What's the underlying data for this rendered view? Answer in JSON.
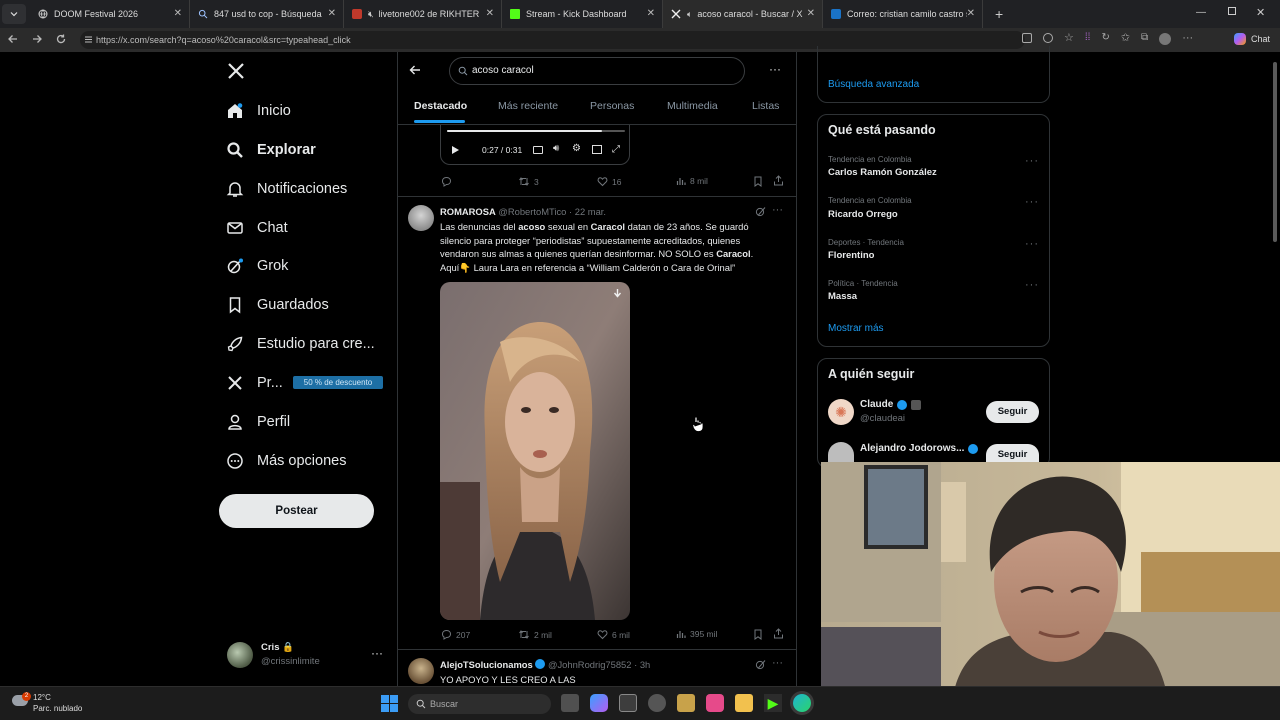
{
  "browser": {
    "tabs": [
      {
        "title": "DOOM Festival 2026",
        "icon": "globe-icon"
      },
      {
        "title": "847 usd to cop - Búsqueda",
        "icon": "search-icon"
      },
      {
        "title": "livetone002 de RIKHTER",
        "icon": "speaker-muted-icon"
      },
      {
        "title": "Stream - Kick Dashboard",
        "icon": "kick-icon"
      },
      {
        "title": "acoso caracol - Buscar / X",
        "icon": "x-logo-icon"
      },
      {
        "title": "Correo: cristian camilo castro soto",
        "icon": "outlook-icon"
      }
    ],
    "url": "https://x.com/search?q=acoso%20caracol&src=typeahead_click",
    "chat_label": "Chat"
  },
  "sidebar": {
    "items": [
      {
        "label": "Inicio",
        "icon": "home-icon"
      },
      {
        "label": "Explorar",
        "icon": "search-icon"
      },
      {
        "label": "Notificaciones",
        "icon": "bell-icon"
      },
      {
        "label": "Chat",
        "icon": "mail-icon"
      },
      {
        "label": "Grok",
        "icon": "grok-icon"
      },
      {
        "label": "Guardados",
        "icon": "bookmark-icon"
      },
      {
        "label": "Estudio para cre...",
        "icon": "rocket-icon"
      },
      {
        "label": "Pr...",
        "icon": "x-logo-icon"
      },
      {
        "label": "Perfil",
        "icon": "person-icon"
      },
      {
        "label": "Más opciones",
        "icon": "more-circle-icon"
      }
    ],
    "premium_badge": "50 % de descuento",
    "post_button": "Postear",
    "account": {
      "name": "Cris 🔒",
      "handle": "@crissinlimite"
    }
  },
  "search": {
    "query": "acoso caracol",
    "tabs": [
      "Destacado",
      "Más reciente",
      "Personas",
      "Multimedia",
      "Listas"
    ],
    "active_tab": "Destacado"
  },
  "feed": {
    "prev_tweet": {
      "player_time": "0:27 / 0:31",
      "replies": "",
      "reposts": "3",
      "likes": "16",
      "views": "8 mil"
    },
    "tweet": {
      "name": "ROMAROSA",
      "handle": "@RobertoMTico",
      "date": "· 22 mar.",
      "text_parts": {
        "p1": "Las denuncias del ",
        "b1": "acoso",
        "p2": " sexual en ",
        "b2": "Caracol",
        "p3": " datan de 23 años. Se guardó silencio para proteger “periodistas” supuestamente acreditados, quienes vendaron sus almas a quienes querían desinformar. NO SOLO es ",
        "b3": "Caracol",
        "p4": ".",
        "line2": "Aquí👇 Laura Lara en referencia a “William Calderón o Cara de Orinal”"
      },
      "replies": "207",
      "reposts": "2 mil",
      "likes": "6 mil",
      "views": "395 mil"
    },
    "next_tweet": {
      "name": "AlejoTSolucionamos",
      "handle": "@JohnRodrig75852",
      "date": "· 3h",
      "text": "YO APOYO Y LES CREO A LAS"
    }
  },
  "right": {
    "advanced_search": "Búsqueda avanzada",
    "trends_title": "Qué está pasando",
    "trends": [
      {
        "category": "Tendencia en Colombia",
        "name": "Carlos Ramón González"
      },
      {
        "category": "Tendencia en Colombia",
        "name": "Ricardo Orrego"
      },
      {
        "category": "Deportes · Tendencia",
        "name": "Florentino"
      },
      {
        "category": "Política · Tendencia",
        "name": "Massa"
      }
    ],
    "show_more": "Mostrar más",
    "who_to_follow_title": "A quién seguir",
    "follow": [
      {
        "name": "Claude",
        "handle": "@claudeai",
        "button": "Seguir"
      },
      {
        "name": "Alejandro Jodorows...",
        "handle": "",
        "button": "Seguir"
      }
    ]
  },
  "taskbar": {
    "weather_temp": "12°C",
    "weather_desc": "Parc. nublado",
    "weather_badge": "2",
    "search_placeholder": "Buscar"
  },
  "colors": {
    "accent": "#1d9bf0",
    "background": "#000000",
    "premium": "#1d6fa5"
  }
}
